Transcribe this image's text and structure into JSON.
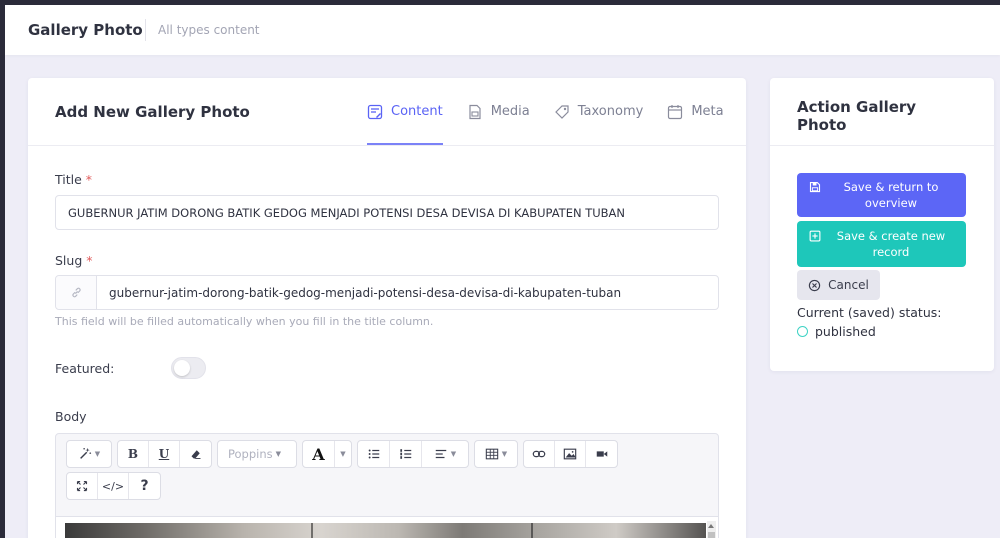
{
  "header": {
    "title": "Gallery Photo",
    "subtitle": "All types content"
  },
  "form": {
    "title": "Add New Gallery Photo",
    "tabs": [
      {
        "label": "Content",
        "icon": "content-icon",
        "active": true
      },
      {
        "label": "Media",
        "icon": "media-icon",
        "active": false
      },
      {
        "label": "Taxonomy",
        "icon": "taxonomy-icon",
        "active": false
      },
      {
        "label": "Meta",
        "icon": "meta-icon",
        "active": false
      }
    ],
    "fields": {
      "title_label": "Title",
      "title_value": "GUBERNUR JATIM DORONG BATIK GEDOG MENJADI POTENSI DESA DEVISA DI KABUPATEN TUBAN",
      "slug_label": "Slug",
      "slug_value": "gubernur-jatim-dorong-batik-gedog-menjadi-potensi-desa-devisa-di-kabupaten-tuban",
      "slug_help": "This field will be filled automatically when you fill in the title column.",
      "required_mark": "*",
      "featured_label": "Featured:",
      "featured_on": false,
      "body_label": "Body"
    },
    "editor": {
      "font_select": "Poppins",
      "bold": "B",
      "underline": "U",
      "help": "?",
      "code": "</>"
    }
  },
  "sidebar": {
    "title": "Action Gallery Photo",
    "save_return": "Save & return to overview",
    "save_create": "Save & create new record",
    "cancel": "Cancel",
    "status_label": "Current (saved) status:",
    "status_value": "published"
  },
  "colors": {
    "primary": "#5c66f6",
    "teal": "#1ec7ba",
    "background": "#eeedf7"
  }
}
